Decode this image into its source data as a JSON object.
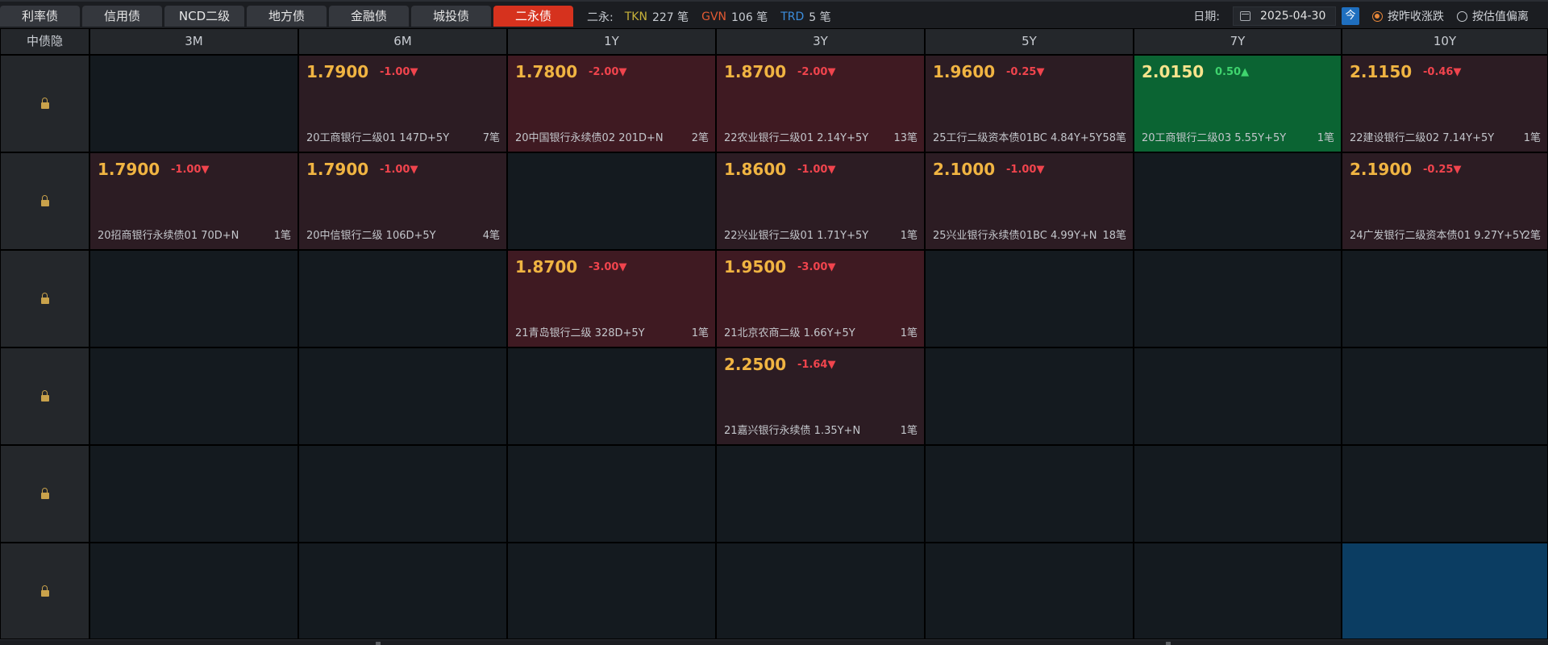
{
  "tabs": [
    "利率债",
    "信用债",
    "NCD二级",
    "地方债",
    "金融债",
    "城投债",
    "二永债"
  ],
  "active_tab": 6,
  "summary": {
    "label": "二永:",
    "tkn_label": "TKN",
    "tkn_count": "227 笔",
    "gvn_label": "GVN",
    "gvn_count": "106 笔",
    "trd_label": "TRD",
    "trd_count": "5 笔"
  },
  "date": {
    "label": "日期:",
    "value": "2025-04-30",
    "today_label": "今"
  },
  "sort_options": {
    "opt1": "按昨收涨跌",
    "opt2": "按估值偏离",
    "selected": "opt1"
  },
  "grid": {
    "corner_label": "中债隐",
    "columns": [
      "3M",
      "6M",
      "1Y",
      "3Y",
      "5Y",
      "7Y",
      "10Y"
    ],
    "rows": [
      [
        null,
        {
          "price": "1.7900",
          "change": "-1.00▼",
          "name": "20工商银行二级01 147D+5Y",
          "count": "7笔",
          "tone": "neg"
        },
        {
          "price": "1.7800",
          "change": "-2.00▼",
          "name": "20中国银行永续债02 201D+N",
          "count": "2笔",
          "tone": "neg2"
        },
        {
          "price": "1.8700",
          "change": "-2.00▼",
          "name": "22农业银行二级01 2.14Y+5Y",
          "count": "13笔",
          "tone": "neg2"
        },
        {
          "price": "1.9600",
          "change": "-0.25▼",
          "name": "25工行二级资本债01BC 4.84Y+5Y",
          "count": "58笔",
          "tone": "neg"
        },
        {
          "price": "2.0150",
          "change": "0.50▲",
          "name": "20工商银行二级03 5.55Y+5Y",
          "count": "1笔",
          "tone": "pos"
        },
        {
          "price": "2.1150",
          "change": "-0.46▼",
          "name": "22建设银行二级02 7.14Y+5Y",
          "count": "1笔",
          "tone": "neg"
        }
      ],
      [
        {
          "price": "1.7900",
          "change": "-1.00▼",
          "name": "20招商银行永续债01 70D+N",
          "count": "1笔",
          "tone": "neg"
        },
        {
          "price": "1.7900",
          "change": "-1.00▼",
          "name": "20中信银行二级 106D+5Y",
          "count": "4笔",
          "tone": "neg"
        },
        null,
        {
          "price": "1.8600",
          "change": "-1.00▼",
          "name": "22兴业银行二级01 1.71Y+5Y",
          "count": "1笔",
          "tone": "neg"
        },
        {
          "price": "2.1000",
          "change": "-1.00▼",
          "name": "25兴业银行永续债01BC 4.99Y+N",
          "count": "18笔",
          "tone": "neg"
        },
        null,
        {
          "price": "2.1900",
          "change": "-0.25▼",
          "name": "24广发银行二级资本债01 9.27Y+5Y",
          "count": "2笔",
          "tone": "neg"
        }
      ],
      [
        null,
        null,
        {
          "price": "1.8700",
          "change": "-3.00▼",
          "name": "21青岛银行二级 328D+5Y",
          "count": "1笔",
          "tone": "neg2"
        },
        {
          "price": "1.9500",
          "change": "-3.00▼",
          "name": "21北京农商二级 1.66Y+5Y",
          "count": "1笔",
          "tone": "neg2"
        },
        null,
        null,
        null
      ],
      [
        null,
        null,
        null,
        {
          "price": "2.2500",
          "change": "-1.64▼",
          "name": "21嘉兴银行永续债 1.35Y+N",
          "count": "1笔",
          "tone": "neg"
        },
        null,
        null,
        null
      ],
      [
        null,
        null,
        null,
        null,
        null,
        null,
        null
      ],
      [
        null,
        null,
        null,
        null,
        null,
        null,
        {
          "tone": "blue"
        }
      ]
    ]
  }
}
